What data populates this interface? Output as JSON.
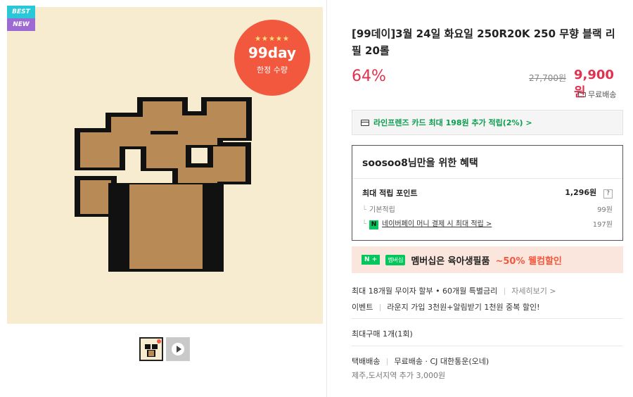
{
  "badges": {
    "best": "BEST",
    "new": "NEW"
  },
  "promo": {
    "stars": "★★★★★",
    "title": "99day",
    "subtitle": "한정 수량"
  },
  "product": {
    "title": "[99데이]3월 24일 화요일 250R20K 250 무향 블랙 리필 20롤",
    "discount": "64%",
    "original_price": "27,700원",
    "sale_price": "9,900원",
    "shipping": "무료배송"
  },
  "card_offer": "라인프렌즈 카드 최대 198원 추가 적립(2%) >",
  "benefit": {
    "heading": "soosoo8님만을 위한 혜택",
    "max_points_label": "최대 적립 포인트",
    "max_points_value": "1,296원",
    "help": "?",
    "basic_label": "기본적립",
    "basic_value": "99원",
    "npay_icon": "N",
    "npay_label": "네이버페이 머니 결제 시 최대 적립 >",
    "npay_value": "197원"
  },
  "membership": {
    "nplus": "N +",
    "badge": "멤버십",
    "text": "멤버십은 육아생필품",
    "highlight": "~50% 웰컴할인"
  },
  "installment": {
    "text": "최대 18개월 무이자 할부 • 60개월 특별금리",
    "link": "자세히보기 >"
  },
  "event": {
    "label": "이벤트",
    "text": "라운지 가입 3천원+알림받기 1천원 중복 할인!"
  },
  "max_purchase": "최대구매 1개(1회)",
  "delivery": {
    "label": "택배배송",
    "detail": "무료배송 · CJ 대한통운(오네)",
    "extra": "제주,도서지역 추가 3,000원"
  },
  "colors": {
    "accent_red": "#e0324f",
    "green": "#03c75a",
    "promo_orange": "#f2583e"
  }
}
